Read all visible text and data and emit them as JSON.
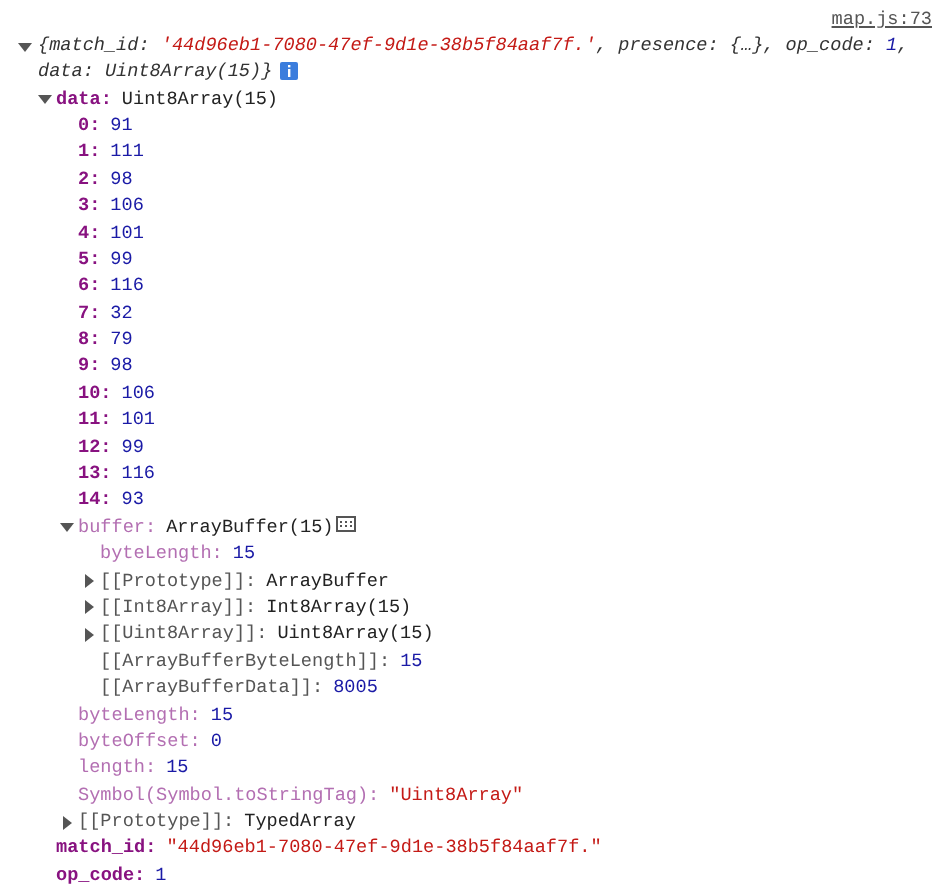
{
  "source_link": "map.js:73",
  "summary": {
    "expanded": true,
    "parts": [
      {
        "kind": "punct",
        "text": "{match_id: "
      },
      {
        "kind": "string",
        "text": "'44d96eb1-7080-47ef-9d1e-38b5f84aaf7f.'"
      },
      {
        "kind": "punct",
        "text": ", presence: {…}, op_code: "
      },
      {
        "kind": "number",
        "text": "1"
      },
      {
        "kind": "punct",
        "text": ", data: Uint8Array(15)}"
      }
    ]
  },
  "properties": [
    {
      "kind": "node",
      "expanded": true,
      "key": {
        "kind": "own",
        "text": "data:"
      },
      "value": {
        "kind": "object",
        "text": "Uint8Array(15)"
      },
      "children": [
        {
          "kind": "leaf",
          "key": {
            "kind": "own",
            "text": "0:"
          },
          "value": {
            "kind": "number",
            "text": "91"
          }
        },
        {
          "kind": "leaf",
          "key": {
            "kind": "own",
            "text": "1:"
          },
          "value": {
            "kind": "number",
            "text": "111"
          }
        },
        {
          "kind": "leaf",
          "key": {
            "kind": "own",
            "text": "2:"
          },
          "value": {
            "kind": "number",
            "text": "98"
          }
        },
        {
          "kind": "leaf",
          "key": {
            "kind": "own",
            "text": "3:"
          },
          "value": {
            "kind": "number",
            "text": "106"
          }
        },
        {
          "kind": "leaf",
          "key": {
            "kind": "own",
            "text": "4:"
          },
          "value": {
            "kind": "number",
            "text": "101"
          }
        },
        {
          "kind": "leaf",
          "key": {
            "kind": "own",
            "text": "5:"
          },
          "value": {
            "kind": "number",
            "text": "99"
          }
        },
        {
          "kind": "leaf",
          "key": {
            "kind": "own",
            "text": "6:"
          },
          "value": {
            "kind": "number",
            "text": "116"
          }
        },
        {
          "kind": "leaf",
          "key": {
            "kind": "own",
            "text": "7:"
          },
          "value": {
            "kind": "number",
            "text": "32"
          }
        },
        {
          "kind": "leaf",
          "key": {
            "kind": "own",
            "text": "8:"
          },
          "value": {
            "kind": "number",
            "text": "79"
          }
        },
        {
          "kind": "leaf",
          "key": {
            "kind": "own",
            "text": "9:"
          },
          "value": {
            "kind": "number",
            "text": "98"
          }
        },
        {
          "kind": "leaf",
          "key": {
            "kind": "own",
            "text": "10:"
          },
          "value": {
            "kind": "number",
            "text": "106"
          }
        },
        {
          "kind": "leaf",
          "key": {
            "kind": "own",
            "text": "11:"
          },
          "value": {
            "kind": "number",
            "text": "101"
          }
        },
        {
          "kind": "leaf",
          "key": {
            "kind": "own",
            "text": "12:"
          },
          "value": {
            "kind": "number",
            "text": "99"
          }
        },
        {
          "kind": "leaf",
          "key": {
            "kind": "own",
            "text": "13:"
          },
          "value": {
            "kind": "number",
            "text": "116"
          }
        },
        {
          "kind": "leaf",
          "key": {
            "kind": "own",
            "text": "14:"
          },
          "value": {
            "kind": "number",
            "text": "93"
          }
        },
        {
          "kind": "node",
          "expanded": true,
          "memory_icon": true,
          "key": {
            "kind": "inherited",
            "text": "buffer:"
          },
          "value": {
            "kind": "object",
            "text": "ArrayBuffer(15)"
          },
          "children": [
            {
              "kind": "leaf",
              "key": {
                "kind": "inherited",
                "text": "byteLength:"
              },
              "value": {
                "kind": "number",
                "text": "15"
              }
            },
            {
              "kind": "node",
              "expanded": false,
              "key": {
                "kind": "internal",
                "text": "[[Prototype]]:"
              },
              "value": {
                "kind": "object",
                "text": "ArrayBuffer"
              }
            },
            {
              "kind": "node",
              "expanded": false,
              "key": {
                "kind": "internal",
                "text": "[[Int8Array]]:"
              },
              "value": {
                "kind": "object",
                "text": "Int8Array(15)"
              }
            },
            {
              "kind": "node",
              "expanded": false,
              "key": {
                "kind": "internal",
                "text": "[[Uint8Array]]:"
              },
              "value": {
                "kind": "object",
                "text": "Uint8Array(15)"
              }
            },
            {
              "kind": "leaf",
              "key": {
                "kind": "internal",
                "text": "[[ArrayBufferByteLength]]:"
              },
              "value": {
                "kind": "number",
                "text": "15"
              }
            },
            {
              "kind": "leaf",
              "key": {
                "kind": "internal",
                "text": "[[ArrayBufferData]]:"
              },
              "value": {
                "kind": "number",
                "text": "8005"
              }
            }
          ]
        },
        {
          "kind": "leaf",
          "key": {
            "kind": "inherited",
            "text": "byteLength:"
          },
          "value": {
            "kind": "number",
            "text": "15"
          }
        },
        {
          "kind": "leaf",
          "key": {
            "kind": "inherited",
            "text": "byteOffset:"
          },
          "value": {
            "kind": "number",
            "text": "0"
          }
        },
        {
          "kind": "leaf",
          "key": {
            "kind": "inherited",
            "text": "length:"
          },
          "value": {
            "kind": "number",
            "text": "15"
          }
        },
        {
          "kind": "leaf",
          "key": {
            "kind": "inherited",
            "text": "Symbol(Symbol.toStringTag):"
          },
          "value": {
            "kind": "string",
            "text": "\"Uint8Array\""
          }
        },
        {
          "kind": "node",
          "expanded": false,
          "key": {
            "kind": "internal",
            "text": "[[Prototype]]:"
          },
          "value": {
            "kind": "object",
            "text": "TypedArray"
          }
        }
      ]
    },
    {
      "kind": "leaf",
      "key": {
        "kind": "own",
        "text": "match_id:"
      },
      "value": {
        "kind": "string",
        "text": "\"44d96eb1-7080-47ef-9d1e-38b5f84aaf7f.\""
      }
    },
    {
      "kind": "leaf",
      "key": {
        "kind": "own",
        "text": "op_code:"
      },
      "value": {
        "kind": "number",
        "text": "1"
      }
    }
  ]
}
